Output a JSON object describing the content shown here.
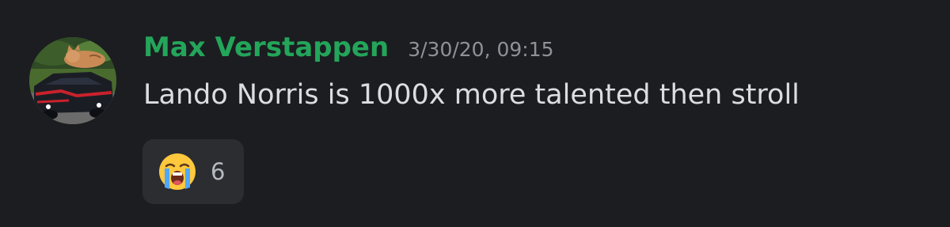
{
  "message": {
    "author": "Max Verstappen",
    "timestamp": "3/30/20, 09:15",
    "text": "Lando Norris is 1000x more talented then stroll",
    "author_color": "#23a55a"
  },
  "reaction": {
    "emoji": "loudly-crying-face-icon",
    "count": "6"
  }
}
